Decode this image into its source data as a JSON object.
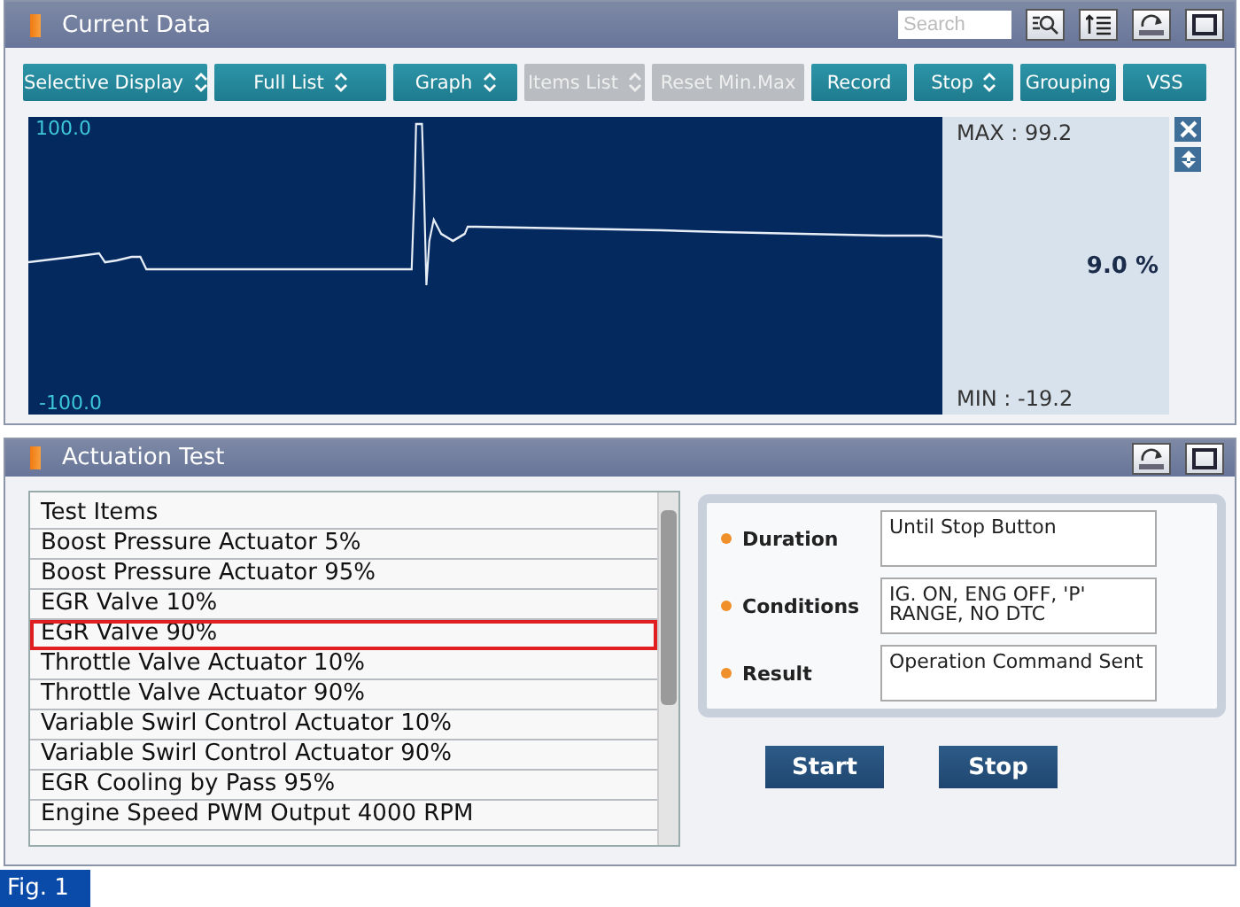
{
  "current_data": {
    "title": "Current Data",
    "search": {
      "placeholder": "Search"
    },
    "toolbar": [
      {
        "label": "Selective Display",
        "kind": "dropdown",
        "disabled": false
      },
      {
        "label": "Full List",
        "kind": "dropdown",
        "disabled": false
      },
      {
        "label": "Graph",
        "kind": "dropdown",
        "disabled": false
      },
      {
        "label": "Items List",
        "kind": "dropdown",
        "disabled": true
      },
      {
        "label": "Reset Min.Max",
        "kind": "plain",
        "disabled": true
      },
      {
        "label": "Record",
        "kind": "plain",
        "disabled": false
      },
      {
        "label": "Stop",
        "kind": "dropdown",
        "disabled": false
      },
      {
        "label": "Grouping",
        "kind": "plain",
        "disabled": false
      },
      {
        "label": "VSS",
        "kind": "plain",
        "disabled": false
      }
    ],
    "graph": {
      "top_label": "100.0",
      "bottom_label": "-100.0",
      "max": "MAX : 99.2",
      "value": "9.0 %",
      "min": "MIN : -19.2"
    }
  },
  "actuation_test": {
    "title": "Actuation Test",
    "list_header": "Test Items",
    "items": [
      {
        "label": "Boost Pressure Actuator 5%",
        "selected": false
      },
      {
        "label": "Boost Pressure Actuator 95%",
        "selected": false
      },
      {
        "label": "EGR Valve 10%",
        "selected": false
      },
      {
        "label": "EGR Valve 90%",
        "selected": true
      },
      {
        "label": "Throttle Valve Actuator 10%",
        "selected": false
      },
      {
        "label": "Throttle Valve Actuator 90%",
        "selected": false
      },
      {
        "label": "Variable Swirl Control Actuator 10%",
        "selected": false
      },
      {
        "label": "Variable Swirl Control Actuator 90%",
        "selected": false
      },
      {
        "label": "EGR Cooling by Pass 95%",
        "selected": false
      },
      {
        "label": "Engine Speed PWM Output 4000 RPM",
        "selected": false
      }
    ],
    "details": [
      {
        "label": "Duration",
        "value": "Until Stop Button"
      },
      {
        "label": "Conditions",
        "value": "IG. ON, ENG OFF, 'P' RANGE, NO DTC"
      },
      {
        "label": "Result",
        "value": "Operation Command Sent"
      }
    ],
    "buttons": [
      "Start",
      "Stop"
    ]
  },
  "figure_label": "Fig. 1"
}
